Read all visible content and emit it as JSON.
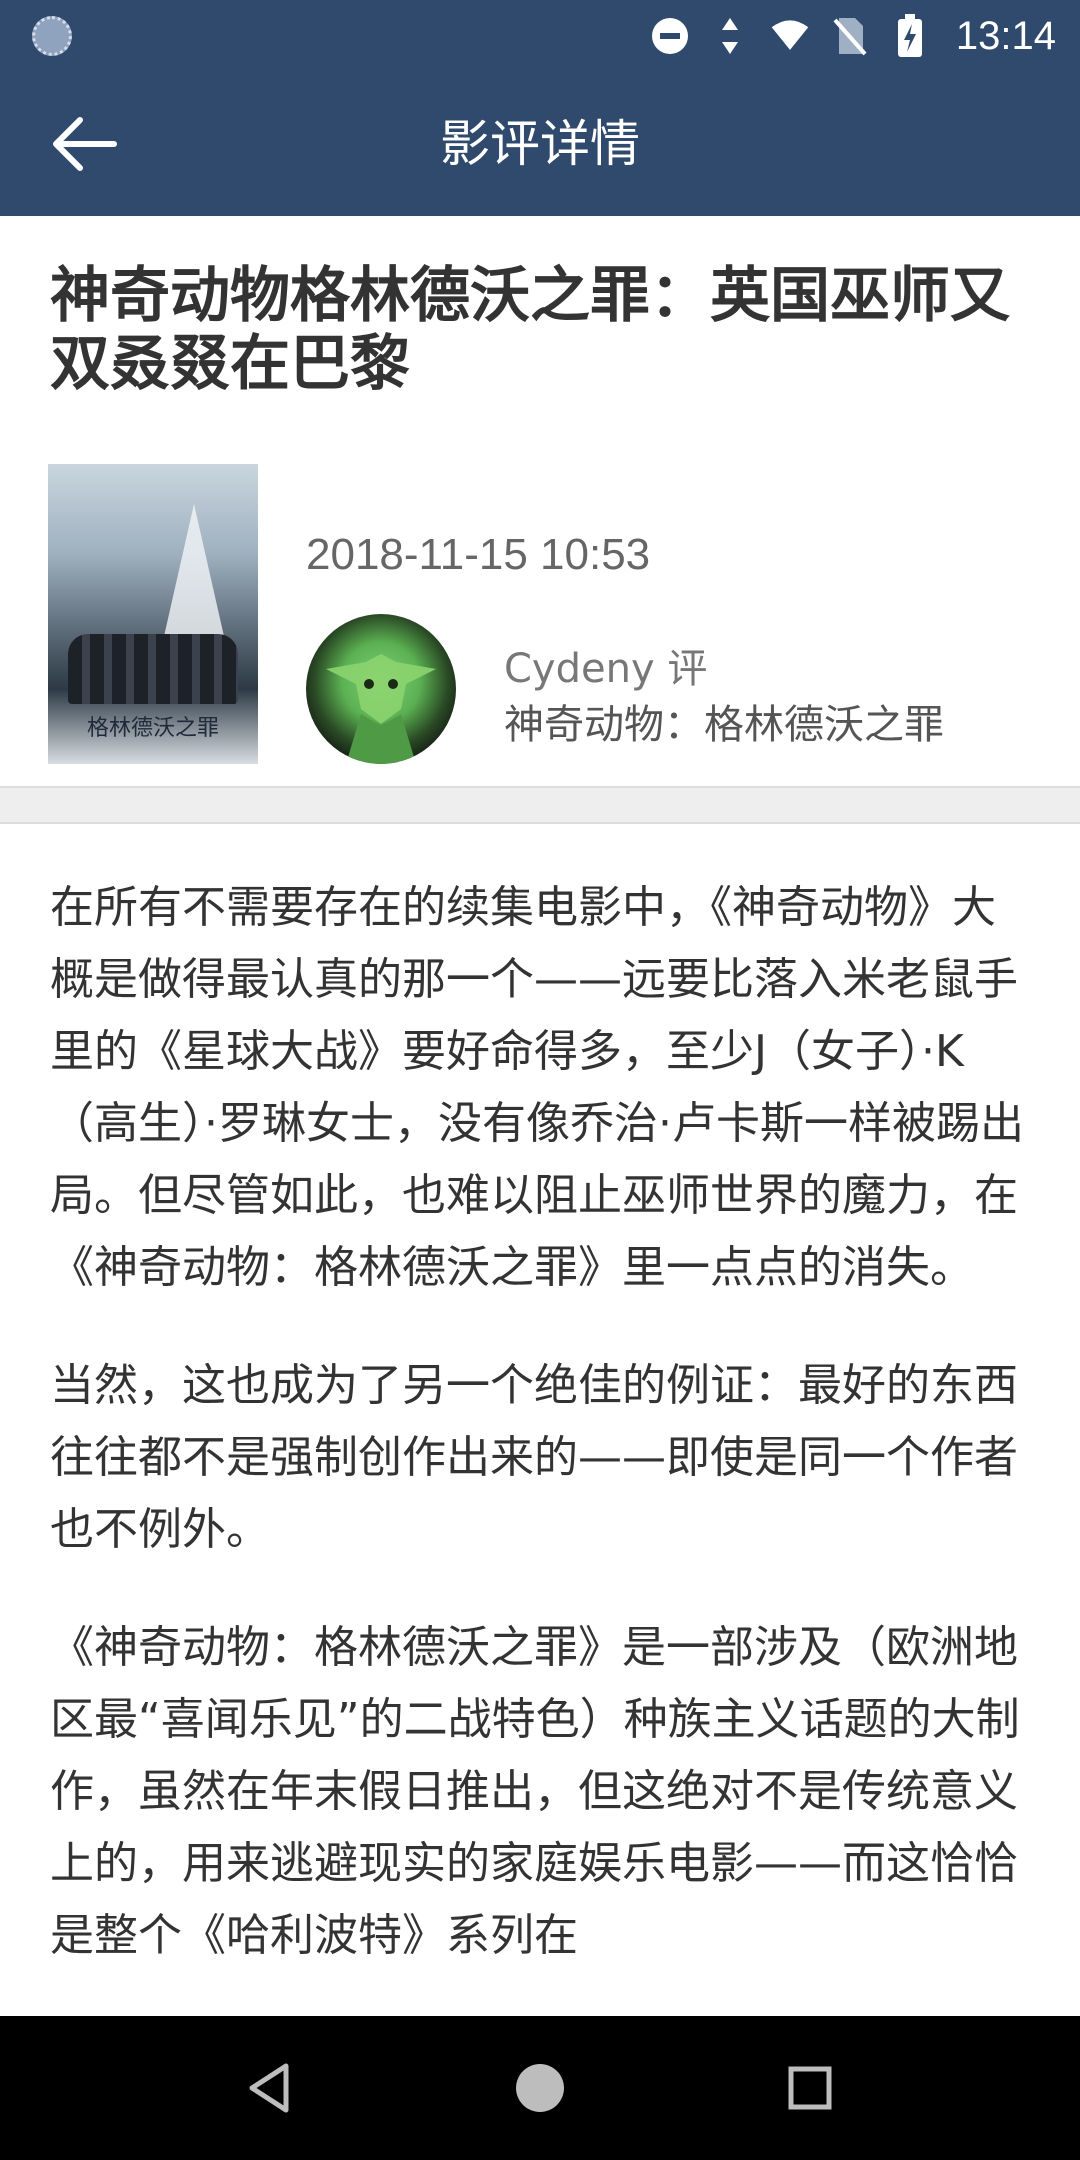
{
  "status_bar": {
    "time": "13:14",
    "icons": [
      "loading-icon",
      "do-not-disturb-icon",
      "data-arrows-icon",
      "wifi-icon",
      "no-sim-icon",
      "battery-charging-icon"
    ]
  },
  "app_bar": {
    "back_icon": "arrow-left-icon",
    "title": "影评详情"
  },
  "article": {
    "title": "神奇动物格林德沃之罪：英国巫师又双叒叕在巴黎",
    "poster_caption": "格林德沃之罪",
    "date": "2018-11-15 10:53",
    "author": "Cydeny 评",
    "movie": "神奇动物：格林德沃之罪",
    "paragraphs": [
      "在所有不需要存在的续集电影中，《神奇动物》大概是做得最认真的那一个——远要比落入米老鼠手里的《星球大战》要好命得多，至少J（女子）·K（高生）·罗琳女士，没有像乔治·卢卡斯一样被踢出局。但尽管如此，也难以阻止巫师世界的魔力，在《神奇动物：格林德沃之罪》里一点点的消失。",
      "当然，这也成为了另一个绝佳的例证：最好的东西往往都不是强制创作出来的——即使是同一个作者也不例外。",
      "《神奇动物：格林德沃之罪》是一部涉及（欧洲地区最“喜闻乐见”的二战特色）种族主义话题的大制作，虽然在年末假日推出，但这绝对不是传统意义上的，用来逃避现实的家庭娱乐电影——而这恰恰是整个《哈利波特》系列在"
    ]
  },
  "nav_bar": {
    "icons": [
      "nav-back-icon",
      "nav-home-icon",
      "nav-recents-icon"
    ]
  },
  "colors": {
    "header": "#2f4a6d",
    "text": "#333333",
    "nav": "#000000"
  }
}
